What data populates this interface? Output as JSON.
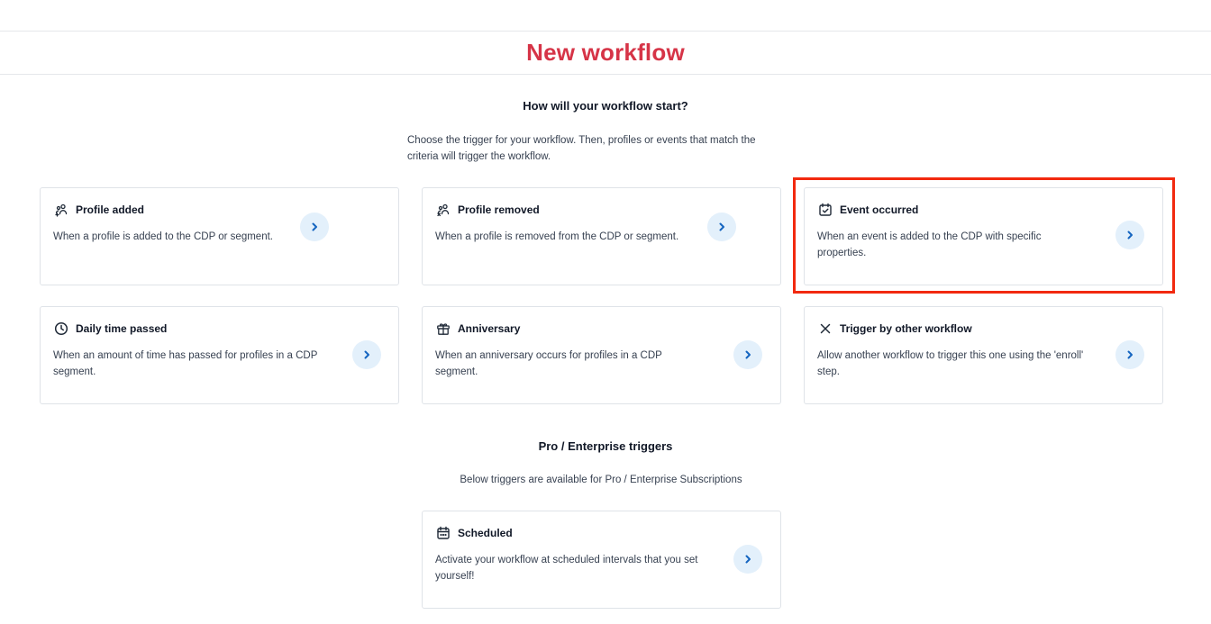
{
  "page": {
    "title": "New workflow"
  },
  "start_section": {
    "heading": "How will your workflow start?",
    "description_line1": "Choose the trigger for your workflow. Then, profiles or events that match the",
    "description_line2": "criteria will trigger the workflow."
  },
  "triggers": [
    {
      "title": "Profile added",
      "description": "When a profile is added to the CDP or segment.",
      "icon": "profile-added-icon"
    },
    {
      "title": "Profile removed",
      "description": "When a profile is removed from the CDP or segment.",
      "icon": "profile-removed-icon"
    },
    {
      "title": "Event occurred",
      "description": "When an event is added to the CDP with specific properties.",
      "icon": "calendar-check-icon"
    },
    {
      "title": "Daily time passed",
      "description": "When an amount of time has passed for profiles in a CDP segment.",
      "icon": "clock-icon"
    },
    {
      "title": "Anniversary",
      "description": "When an anniversary occurs for profiles in a CDP segment.",
      "icon": "gift-icon"
    },
    {
      "title": "Trigger by other workflow",
      "description": "Allow another workflow to trigger this one using the 'enroll' step.",
      "icon": "close-x-icon"
    }
  ],
  "pro_section": {
    "heading": "Pro / Enterprise triggers",
    "description": "Below triggers are available for Pro / Enterprise Subscriptions",
    "triggers": [
      {
        "title": "Scheduled",
        "description": "Activate your workflow at scheduled intervals that you set yourself!",
        "icon": "calendar-dots-icon"
      }
    ]
  },
  "colors": {
    "title": "#d63447",
    "arrow_bg": "#e3f0fb",
    "arrow": "#1565c0",
    "highlight": "#f2290f",
    "border": "#dfe3e8"
  }
}
